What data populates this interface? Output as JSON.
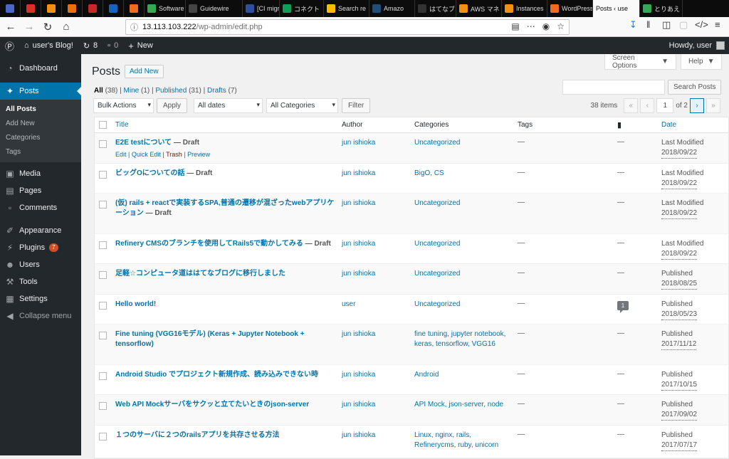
{
  "browser": {
    "tabs": [
      {
        "label": "",
        "fav": "#4a66c9",
        "pinned": true
      },
      {
        "label": "",
        "fav": "#d93025",
        "pinned": true
      },
      {
        "label": "",
        "fav": "#f29111",
        "pinned": true
      },
      {
        "label": "",
        "fav": "#e8710a",
        "pinned": true
      },
      {
        "label": "",
        "fav": "#c62828",
        "pinned": true
      },
      {
        "label": "",
        "fav": "#1565c0",
        "pinned": true
      },
      {
        "label": "",
        "fav": "#f06b22",
        "pinned": true
      },
      {
        "label": "Software",
        "fav": "#34a853",
        "pinned": false,
        "w": 58
      },
      {
        "label": "Guidewire",
        "fav": "#444",
        "pinned": false,
        "w": 80
      },
      {
        "label": "[CI migrati",
        "fav": "#2d4f9e",
        "pinned": false,
        "w": 52
      },
      {
        "label": "コネクト",
        "fav": "#0f9d58",
        "pinned": false,
        "w": 62
      },
      {
        "label": "Search re",
        "fav": "#fbbc04",
        "pinned": false,
        "w": 64
      },
      {
        "label": "Amazo",
        "fav": "#1f4e79",
        "pinned": false,
        "w": 64
      },
      {
        "label": "はてなブ",
        "fav": "#333",
        "pinned": false,
        "w": 58
      },
      {
        "label": "AWS マネ",
        "fav": "#f29111",
        "pinned": false,
        "w": 64
      },
      {
        "label": "Instances",
        "fav": "#f29111",
        "pinned": false,
        "w": 64
      },
      {
        "label": "WordPress",
        "fav": "#f06b22",
        "pinned": false,
        "w": 64
      },
      {
        "label": "Posts ‹ use",
        "fav": "",
        "pinned": false,
        "w": 66,
        "active": true
      },
      {
        "label": "とりあえ",
        "fav": "#34a853",
        "pinned": false,
        "w": 60
      }
    ],
    "url_host": "13.113.103.222",
    "url_path": "/wp-admin/edit.php"
  },
  "adminbar": {
    "site_name": "user's Blog!",
    "updates_count": "8",
    "comments_count": "0",
    "new_label": "New",
    "howdy": "Howdy, user"
  },
  "sidebar": {
    "dashboard": "Dashboard",
    "posts": "Posts",
    "sub": [
      "All Posts",
      "Add New",
      "Categories",
      "Tags"
    ],
    "media": "Media",
    "pages": "Pages",
    "comments": "Comments",
    "appearance": "Appearance",
    "plugins": "Plugins",
    "plugins_badge": "7",
    "users": "Users",
    "tools": "Tools",
    "settings": "Settings",
    "collapse": "Collapse menu"
  },
  "header": {
    "screen_options": "Screen Options",
    "help": "Help",
    "title": "Posts",
    "add_new": "Add New"
  },
  "filters": {
    "all": "All",
    "all_count": "(38)",
    "mine": "Mine",
    "mine_count": "(1)",
    "published": "Published",
    "published_count": "(31)",
    "drafts": "Drafts",
    "drafts_count": "(7)",
    "search_button": "Search Posts",
    "bulk_actions": "Bulk Actions",
    "apply": "Apply",
    "dates": "All dates",
    "categories": "All Categories",
    "filter": "Filter",
    "items": "38 items",
    "current_page": "1",
    "of_pages": "of 2"
  },
  "columns": {
    "title": "Title",
    "author": "Author",
    "categories": "Categories",
    "tags": "Tags",
    "date": "Date"
  },
  "row_actions": {
    "edit": "Edit",
    "quick_edit": "Quick Edit",
    "trash": "Trash",
    "preview": "Preview"
  },
  "posts": [
    {
      "title": "E2E testについて",
      "state": " — Draft",
      "author": "jun ishioka",
      "categories": "Uncategorized",
      "tags": "—",
      "comments": "—",
      "date_status": "Last Modified",
      "date": "2018/09/22"
    },
    {
      "title": "ビッグOについての話",
      "state": " — Draft",
      "author": "jun ishioka",
      "categories": "BigO, CS",
      "tags": "—",
      "comments": "—",
      "date_status": "Last Modified",
      "date": "2018/09/22"
    },
    {
      "title": "(仮) rails + reactで実装するSPA,普通の遷移が混ざったwebアプリケーション",
      "state": " — Draft",
      "author": "jun ishioka",
      "categories": "Uncategorized",
      "tags": "—",
      "comments": "—",
      "date_status": "Last Modified",
      "date": "2018/09/22"
    },
    {
      "title": "Refinery CMSのブランチを使用してRails5で動かしてみる",
      "state": " — Draft",
      "author": "jun ishioka",
      "categories": "Uncategorized",
      "tags": "—",
      "comments": "—",
      "date_status": "Last Modified",
      "date": "2018/09/22"
    },
    {
      "title": "足軽☆コンピュータ道ははてなブログに移行しました",
      "state": "",
      "author": "jun ishioka",
      "categories": "Uncategorized",
      "tags": "—",
      "comments": "—",
      "date_status": "Published",
      "date": "2018/08/25"
    },
    {
      "title": "Hello world!",
      "state": "",
      "author": "user",
      "categories": "Uncategorized",
      "tags": "—",
      "comments": "1",
      "date_status": "Published",
      "date": "2018/05/23"
    },
    {
      "title": "Fine tuning (VGG16モデル) (Keras + Jupyter Notebook + tensorflow)",
      "state": "",
      "author": "jun ishioka",
      "categories": "fine tuning, jupyter notebook, keras, tensorflow, VGG16",
      "tags": "—",
      "comments": "—",
      "date_status": "Published",
      "date": "2017/11/12"
    },
    {
      "title": "Android Studio でプロジェクト新規作成、読み込みできない時",
      "state": "",
      "author": "jun ishioka",
      "categories": "Android",
      "tags": "—",
      "comments": "—",
      "date_status": "Published",
      "date": "2017/10/15"
    },
    {
      "title": "Web API Mockサーバをサクッと立てたいときのjson-server",
      "state": "",
      "author": "jun ishioka",
      "categories": "API Mock, json-server, node",
      "tags": "—",
      "comments": "—",
      "date_status": "Published",
      "date": "2017/09/02"
    },
    {
      "title": "１つのサーバに２つのrailsアプリを共存させる方法",
      "state": "",
      "author": "jun ishioka",
      "categories": "Linux, nginx, rails, Refinerycms, ruby, unicorn",
      "tags": "—",
      "comments": "—",
      "date_status": "Published",
      "date": "2017/07/17"
    }
  ]
}
